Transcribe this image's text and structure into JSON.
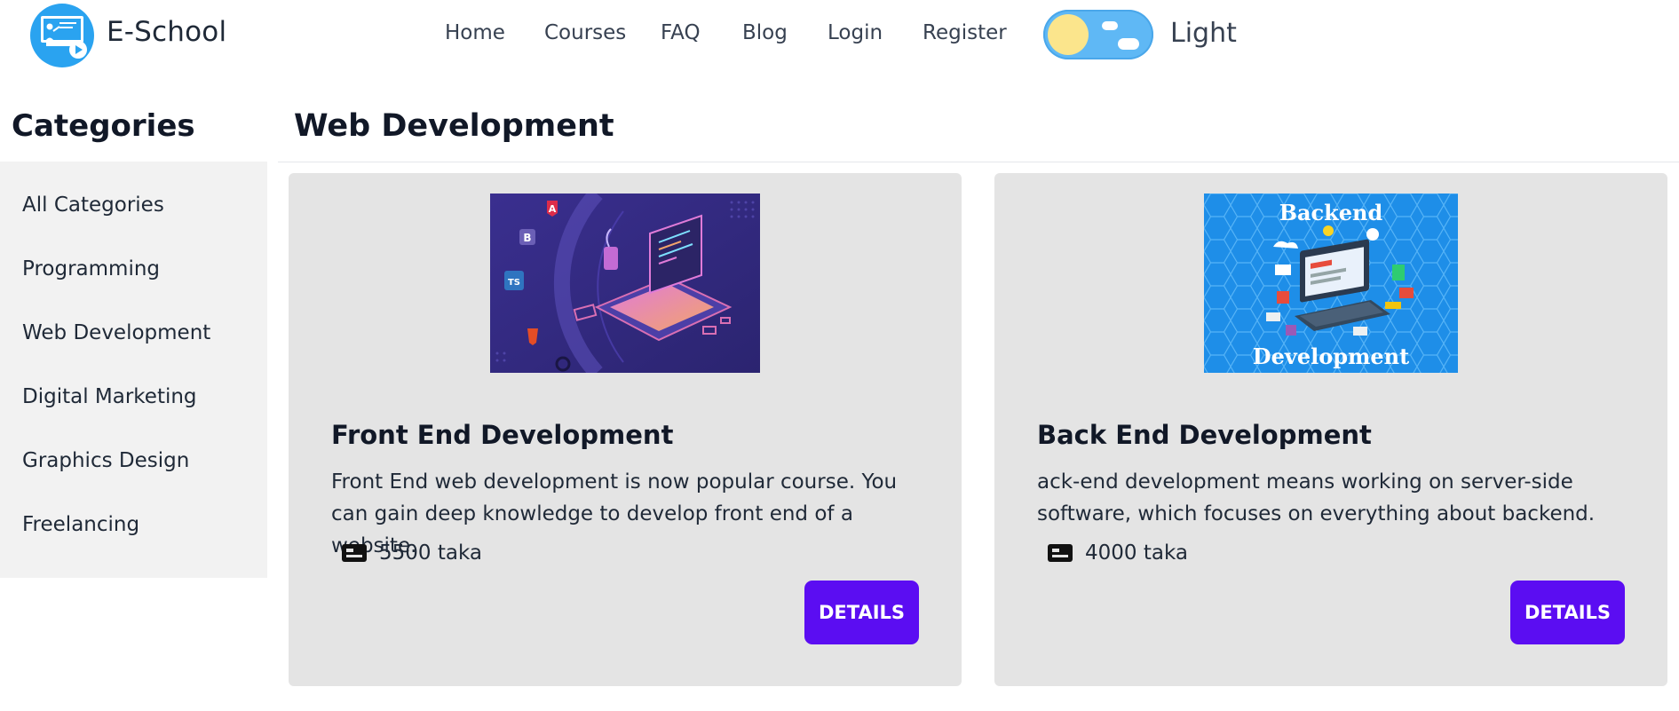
{
  "brand": {
    "name": "E-School",
    "logo_icon": "teacher-screen-icon"
  },
  "nav": {
    "items": [
      {
        "label": "Home"
      },
      {
        "label": "Courses"
      },
      {
        "label": "FAQ"
      },
      {
        "label": "Blog"
      },
      {
        "label": "Login"
      },
      {
        "label": "Register"
      }
    ]
  },
  "theme": {
    "label": "Light",
    "icon": "sun-cloud-toggle-icon"
  },
  "sidebar": {
    "title": "Categories",
    "items": [
      {
        "label": "All Categories"
      },
      {
        "label": "Programming"
      },
      {
        "label": "Web Development"
      },
      {
        "label": "Digital Marketing"
      },
      {
        "label": "Graphics Design"
      },
      {
        "label": "Freelancing"
      }
    ]
  },
  "main": {
    "title": "Web Development",
    "courses": [
      {
        "title": "Front End Development",
        "description": "Front End web development is now popular course. You can gain deep knowledge to develop front end of a website.",
        "price": "5500 taka",
        "button": "DETAILS",
        "image_icons": [
          "A",
          "B",
          "TS"
        ]
      },
      {
        "title": "Back End Development",
        "description": "ack-end development means working on server-side software, which focuses on everything about backend.",
        "price": "4000 taka",
        "button": "DETAILS",
        "image_text_top": "Backend",
        "image_text_bottom": "Development"
      }
    ]
  },
  "colors": {
    "accent": "#5b0df2",
    "card_bg": "#e4e4e4",
    "sidebar_bg": "#f2f2f2",
    "logo_bg": "#2aa3f0",
    "toggle_bg": "#5fb8f5"
  }
}
